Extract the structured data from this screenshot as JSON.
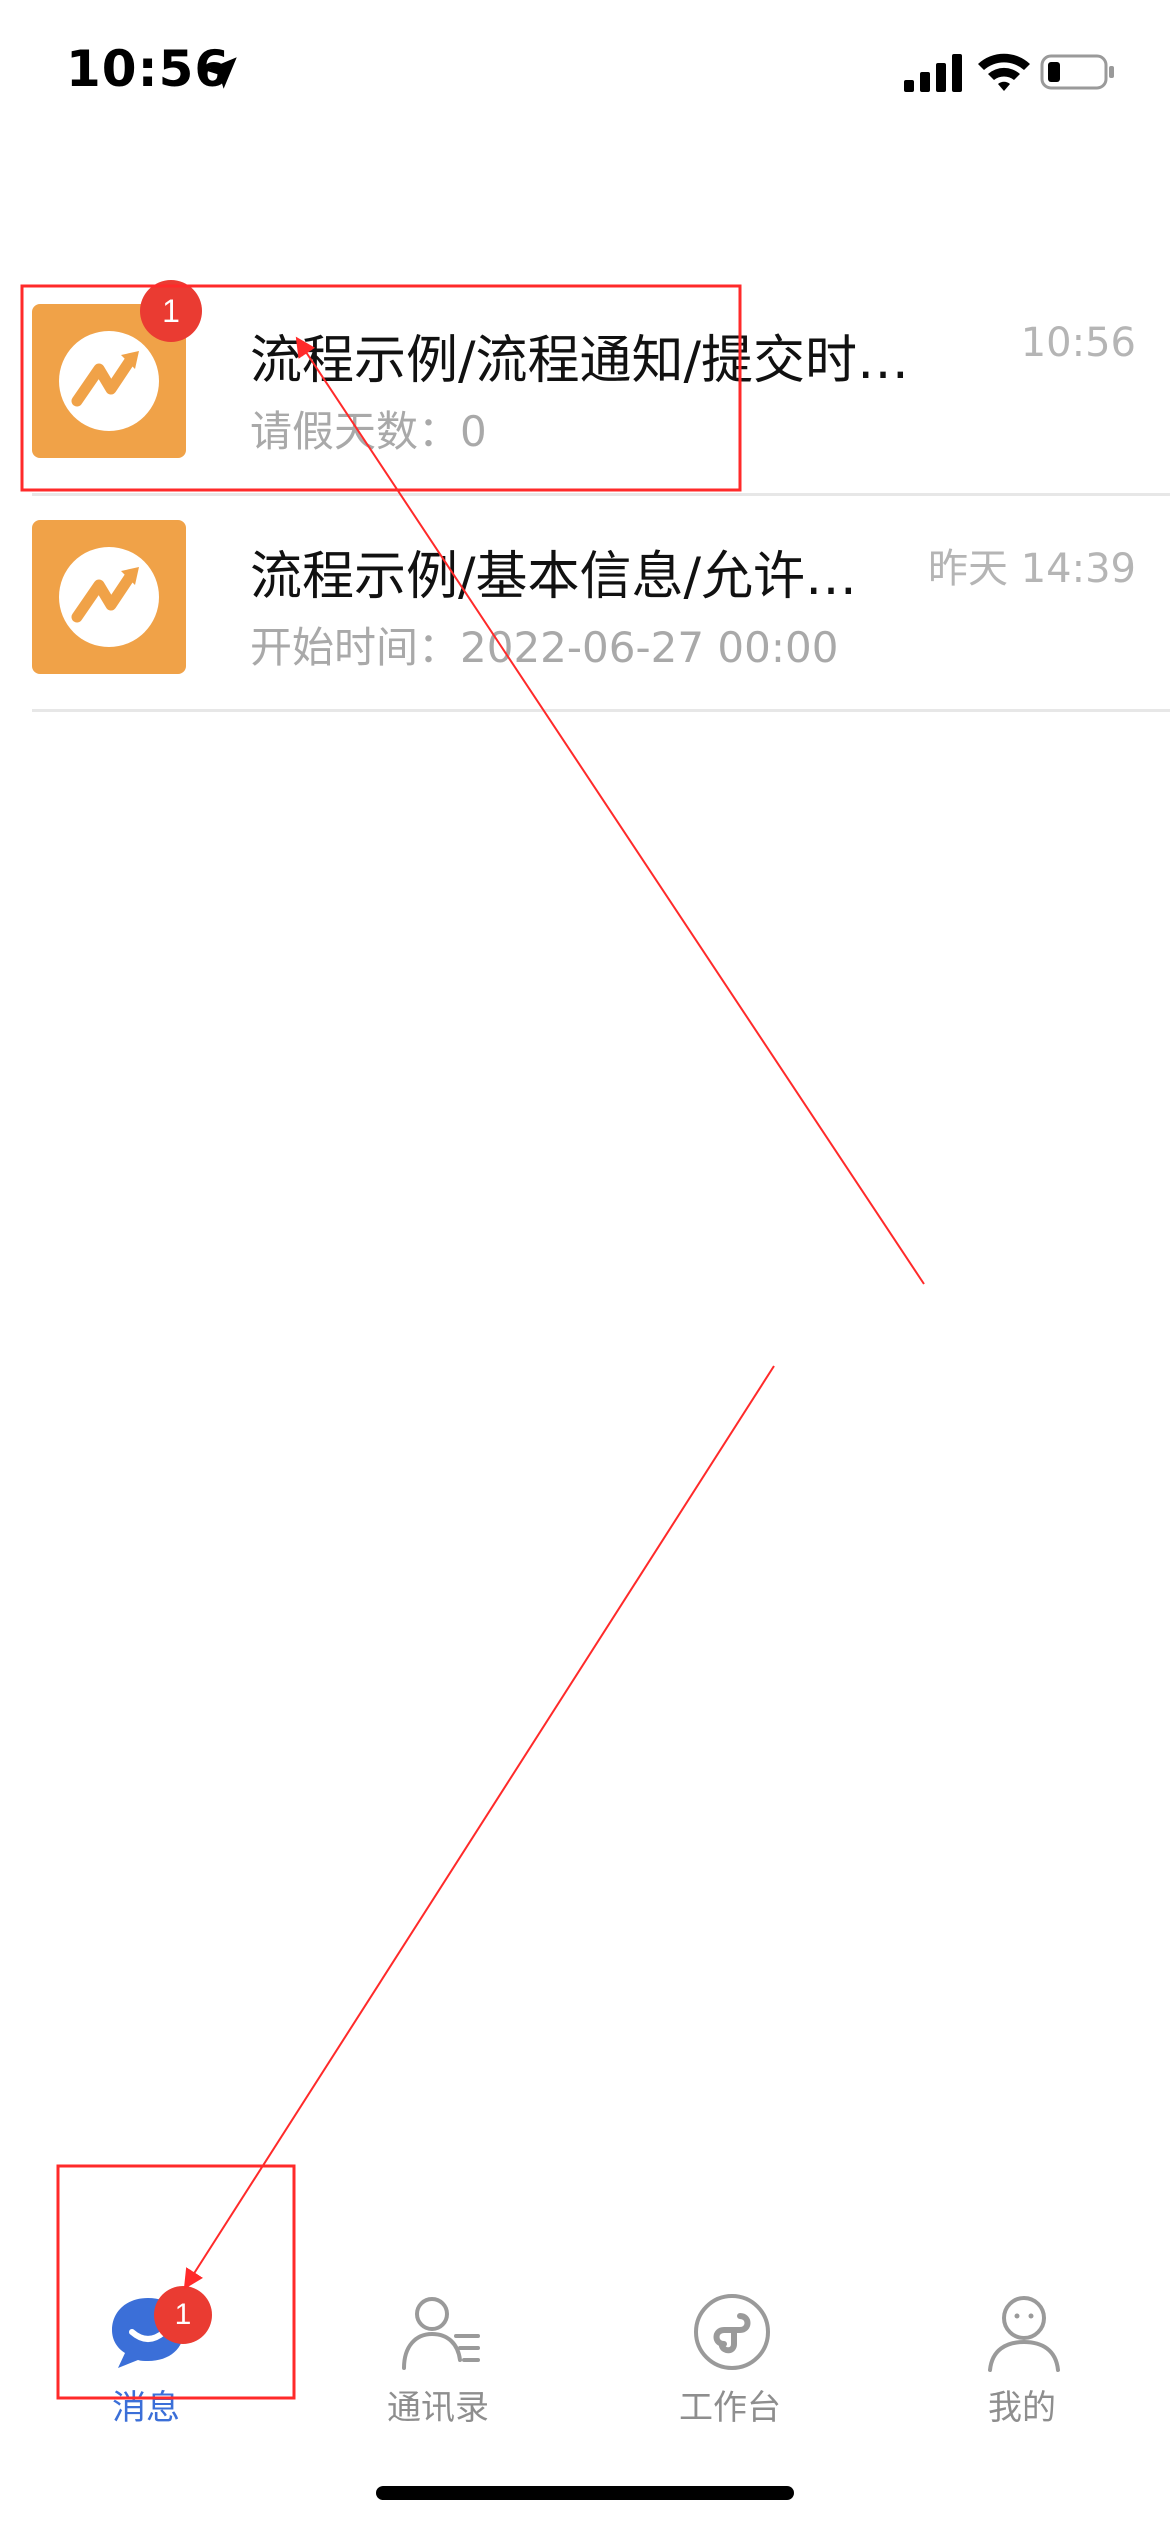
{
  "status_bar": {
    "time": "10:56"
  },
  "messages": [
    {
      "title": "流程示例/流程通知/提交时…",
      "subtitle": "请假天数：0",
      "time": "10:56",
      "badge": "1",
      "icon": "trend-arrow-icon"
    },
    {
      "title": "流程示例/基本信息/允许…",
      "subtitle": "开始时间：2022-06-27 00:00",
      "time": "昨天 14:39",
      "badge": "",
      "icon": "trend-arrow-icon"
    }
  ],
  "tab_bar": {
    "tabs": [
      {
        "label": "消息",
        "icon": "chat-bubble-icon",
        "badge": "1",
        "active": true
      },
      {
        "label": "通讯录",
        "icon": "contacts-icon",
        "badge": "",
        "active": false
      },
      {
        "label": "工作台",
        "icon": "mini-program-icon",
        "badge": "",
        "active": false
      },
      {
        "label": "我的",
        "icon": "profile-icon",
        "badge": "",
        "active": false
      }
    ]
  },
  "colors": {
    "accent": "#3b6fd8",
    "avatar": "#f0a248",
    "badge": "#ea3b32",
    "annotation": "#ff2a2a"
  }
}
